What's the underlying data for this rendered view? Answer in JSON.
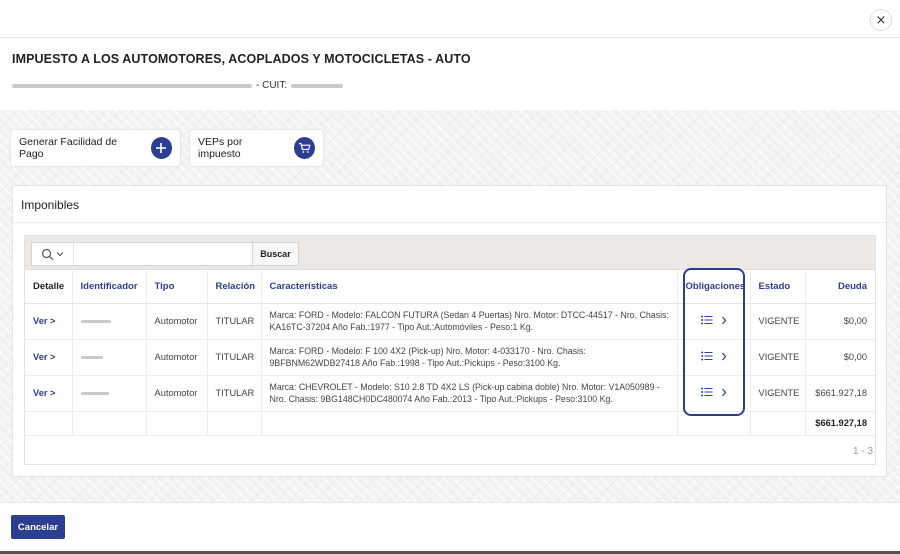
{
  "dialog": {
    "close_label": "×"
  },
  "header": {
    "title": "IMPUESTO A LOS AUTOMOTORES, ACOPLADOS Y MOTOCICLETAS - AUTO",
    "cuit_label": "- CUIT:"
  },
  "actions": {
    "generar_label": "Generar Facilidad de Pago",
    "generar_icon": "plus-icon",
    "veps_label": "VEPs por impuesto",
    "veps_icon": "cart-icon"
  },
  "panel": {
    "title": "Imponibles"
  },
  "search": {
    "placeholder": "",
    "value": "",
    "button_label": "Buscar"
  },
  "table": {
    "columns": [
      "Detalle",
      "Identificador",
      "Tipo",
      "Relación",
      "Características",
      "Obligaciones",
      "Estado",
      "Deuda"
    ],
    "rows": [
      {
        "detalle": "Ver >",
        "tipo": "Automotor",
        "relacion": "TITULAR",
        "caracteristicas": "Marca: FORD - Modelo: FALCON FUTURA (Sedan 4 Puertas) Nro. Motor: DTCC-44517 - Nro. Chasis: KA16TC-37204 Año Fab.:1977 - Tipo Aut.:Automóviles - Peso:1 Kg.",
        "estado": "VIGENTE",
        "deuda": "$0,00"
      },
      {
        "detalle": "Ver >",
        "tipo": "Automotor",
        "relacion": "TITULAR",
        "caracteristicas": "Marca: FORD - Modelo: F 100 4X2 (Pick-up) Nro. Motor: 4-033170 - Nro. Chasis: 9BFBNM62WDB27418 Año Fab.:1998 - Tipo Aut.:Pickups - Peso:3100 Kg.",
        "estado": "VIGENTE",
        "deuda": "$0,00"
      },
      {
        "detalle": "Ver >",
        "tipo": "Automotor",
        "relacion": "TITULAR",
        "caracteristicas": "Marca: CHEVROLET - Modelo: S10 2.8 TD 4X2 LS (Pick-up cabina doble) Nro. Motor: V1A050989 - Nro. Chasis: 9BG148CH0DC480074 Año Fab.:2013 - Tipo Aut.:Pickups - Peso:3100 Kg.",
        "estado": "VIGENTE",
        "deuda": "$661.927,18"
      }
    ],
    "total": "$661.927,18",
    "pagination": "1 - 3"
  },
  "footer": {
    "cancel_label": "Cancelar"
  },
  "colors": {
    "primary": "#2c3e8f",
    "toolbar_bg": "#ebe8e6"
  }
}
